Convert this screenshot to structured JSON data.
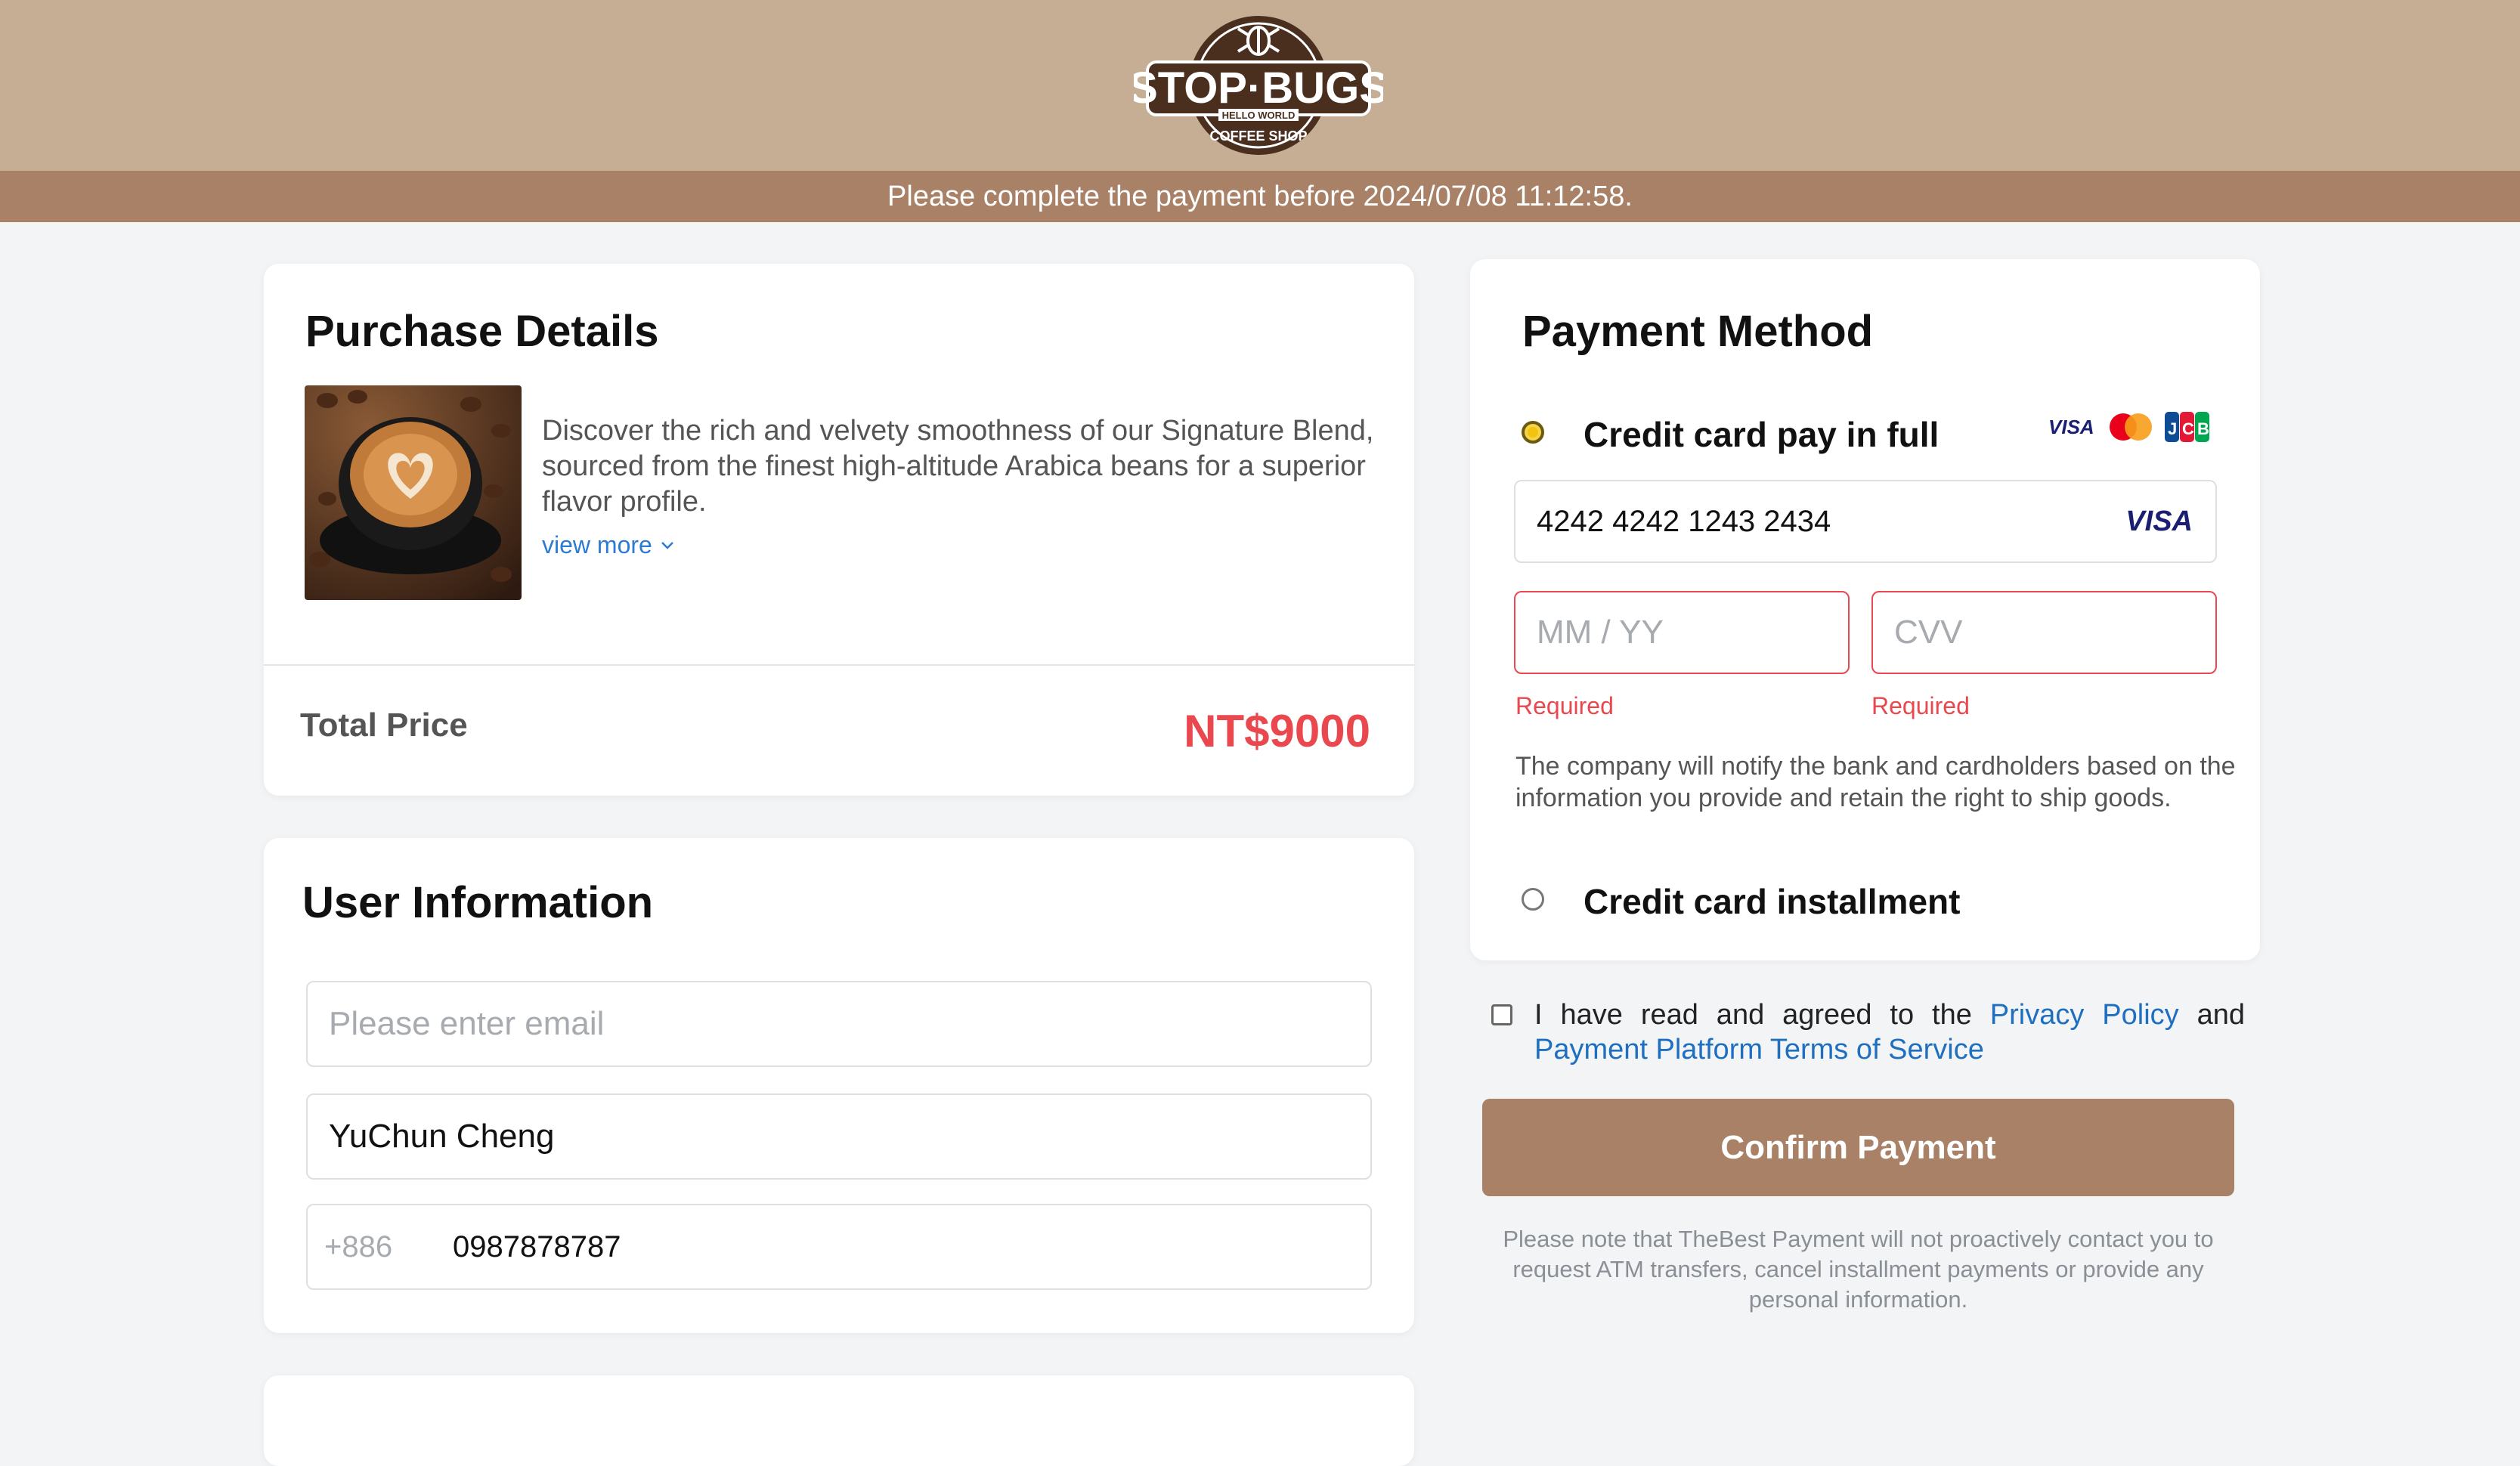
{
  "header": {
    "brand_name": "STOP·BUGS",
    "brand_tagline": "HELLO WORLD",
    "brand_sub": "COFFEE SHOP",
    "deadline_text": "Please complete the payment before 2024/07/08 11:12:58."
  },
  "purchase": {
    "title": "Purchase Details",
    "description": "Discover the rich and velvety smoothness of our Signature Blend, sourced from the finest high-altitude Arabica beans for a superior flavor profile.",
    "view_more": "view more",
    "total_label": "Total Price",
    "total_value": "NT$9000"
  },
  "user": {
    "title": "User Information",
    "email_placeholder": "Please enter email",
    "name_value": "YuChun Cheng",
    "phone_prefix": "+886",
    "phone_value": "0987878787"
  },
  "payment": {
    "title": "Payment Method",
    "option_full": "Credit card pay in full",
    "option_installment": "Credit card installment",
    "card_number": "4242 4242 1243 2434",
    "card_brand": "VISA",
    "expiry_placeholder": "MM / YY",
    "cvv_placeholder": "CVV",
    "required_text": "Required",
    "notice": "The company will notify the bank and cardholders based on the information you provide and retain the right to ship goods.",
    "accepted_brands": [
      "VISA",
      "Mastercard",
      "JCB"
    ]
  },
  "agreement": {
    "prefix": "I have read and agreed to the",
    "privacy_link": "Privacy Policy",
    "and": "and",
    "terms_link": "Payment Platform Terms of Service"
  },
  "confirm_label": "Confirm Payment",
  "footnote": "Please note that TheBest Payment will not proactively contact you to request ATM transfers, cancel installment payments or provide any personal information.",
  "colors": {
    "header_bg": "#c6ae94",
    "accent_brown": "#a88167",
    "price_red": "#e8484e",
    "link_blue": "#1f6fc0"
  }
}
